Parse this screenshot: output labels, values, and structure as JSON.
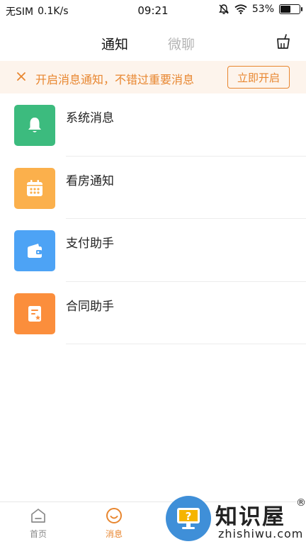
{
  "status_bar": {
    "carrier": "无SIM",
    "speed": "0.1K/s",
    "time": "09:21",
    "battery": "53%",
    "battery_level": 0.53,
    "icons": [
      "mute-icon",
      "wifi-icon",
      "battery-icon"
    ]
  },
  "header": {
    "tabs": [
      {
        "label": "通知",
        "active": true
      },
      {
        "label": "微聊",
        "active": false
      }
    ],
    "clear_icon": "broom-icon"
  },
  "banner": {
    "text": "开启消息通知，不错过重要消息",
    "button_label": "立即开启",
    "close_icon": "close-icon"
  },
  "messages": [
    {
      "title": "系统消息",
      "icon": "bell-icon",
      "color": "#3cbb7e"
    },
    {
      "title": "看房通知",
      "icon": "calendar-icon",
      "color": "#fbb04c"
    },
    {
      "title": "支付助手",
      "icon": "wallet-icon",
      "color": "#4da3f5"
    },
    {
      "title": "合同助手",
      "icon": "contract-icon",
      "color": "#fb8e3c"
    }
  ],
  "bottom_nav": {
    "items": [
      {
        "label": "首页",
        "icon": "home-icon",
        "active": false
      },
      {
        "label": "消息",
        "icon": "smile-message-icon",
        "active": true
      }
    ]
  },
  "watermark": {
    "cn": "知识屋",
    "en": "zhishiwu.com",
    "reg": "®"
  },
  "colors": {
    "accent": "#e8862f",
    "banner_bg": "#fdf4ec",
    "inactive_tab": "#b4b4b4"
  }
}
